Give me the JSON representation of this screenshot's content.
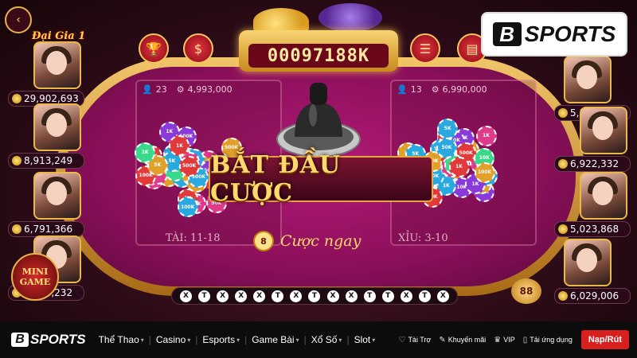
{
  "game": {
    "jackpot": "00097188K",
    "banner": "BẮT ĐẦU CƯỢC",
    "bet_now": "Cược ngay",
    "bet_now_badge": "8",
    "left_zone": {
      "players": "23",
      "amount": "4,993,000",
      "label": "TÀI: 11-18"
    },
    "right_zone": {
      "players": "13",
      "amount": "6,990,000",
      "label": "XỈU: 3-10"
    },
    "history": [
      "X",
      "T",
      "X",
      "X",
      "X",
      "T",
      "X",
      "T",
      "X",
      "X",
      "T",
      "T",
      "X",
      "T",
      "X"
    ],
    "vip_label": "Đại Gia 1",
    "mini_game": [
      "MINI",
      "GAME"
    ],
    "chat_badge": "88",
    "left_players": [
      {
        "balance": "29,902,693"
      },
      {
        "balance": "8,913,249"
      },
      {
        "balance": "6,791,366"
      },
      {
        "balance": "5,674,232"
      }
    ],
    "right_players": [
      {
        "balance": "5,136,225"
      },
      {
        "balance": "6,922,332"
      },
      {
        "balance": "5,023,868"
      },
      {
        "balance": "6,029,006"
      }
    ],
    "chip_labels": [
      "10K",
      "50K",
      "100K",
      "500K",
      "1K",
      "5K"
    ],
    "icons": [
      "trophy-icon",
      "dollar-icon",
      "list-icon",
      "chart-icon",
      "back-arrow-icon",
      "user-icon",
      "gear-icon"
    ]
  },
  "watermark": {
    "letter": "B",
    "word": "SPORTS"
  },
  "navbar": {
    "logo_letter": "B",
    "logo_word": "SPORTS",
    "menu": [
      "Thể Thao",
      "Casino",
      "Esports",
      "Game Bài",
      "Xổ Số",
      "Slot"
    ],
    "utils": [
      {
        "label": "Tài Trợ",
        "icon": "sponsor-icon"
      },
      {
        "label": "Khuyến mãi",
        "icon": "promo-icon"
      },
      {
        "label": "VIP",
        "icon": "vip-icon"
      },
      {
        "label": "Tải ứng dụng",
        "icon": "download-app-icon"
      }
    ],
    "cta": "Nạp/Rút"
  }
}
